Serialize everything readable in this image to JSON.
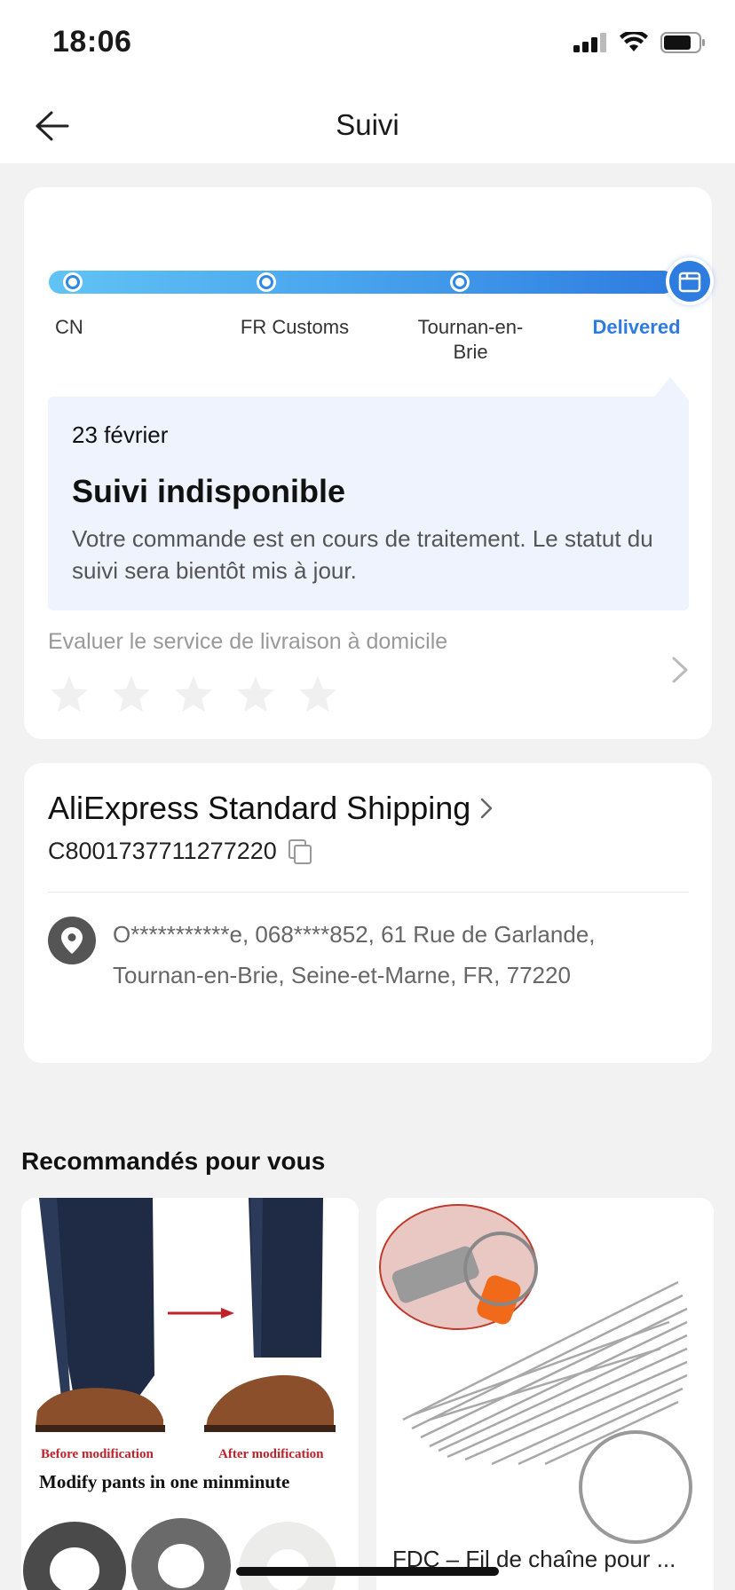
{
  "status": {
    "time": "18:06"
  },
  "nav": {
    "title": "Suivi"
  },
  "tracking": {
    "stages": [
      "CN",
      "FR Customs",
      "Tournan-en-Brie",
      "Delivered"
    ],
    "date": "23 février",
    "title": "Suivi indisponible",
    "description": "Votre commande est en cours de traitement. Le statut du suivi sera bientôt mis à jour.",
    "rate_label": "Evaluer le service de livraison à domicile",
    "rating": 0,
    "max_rating": 5
  },
  "shipping": {
    "carrier": "AliExpress Standard Shipping",
    "tracking_number": "C8001737711277220",
    "address": "O***********e,  068****852,  61 Rue de Garlande,  Tournan-en-Brie,  Seine-et-Marne,  FR,  77220"
  },
  "recommendations": {
    "title": "Recommandés pour vous",
    "products": [
      {
        "caption_before": "Before modification",
        "caption_after": "After modification",
        "headline": "Modify pants in one minminute"
      },
      {
        "title": "FDC – Fil de chaîne pour ..."
      }
    ]
  },
  "colors": {
    "accent": "#2e7ce0",
    "progress_start": "#61c3f5",
    "info_bg": "#eef3fd",
    "page_bg": "#f2f2f2"
  },
  "icons": [
    "signal-icon",
    "wifi-icon",
    "battery-icon",
    "back-arrow-icon",
    "package-icon",
    "chevron-right-icon",
    "star-icon",
    "copy-icon",
    "location-pin-icon"
  ]
}
